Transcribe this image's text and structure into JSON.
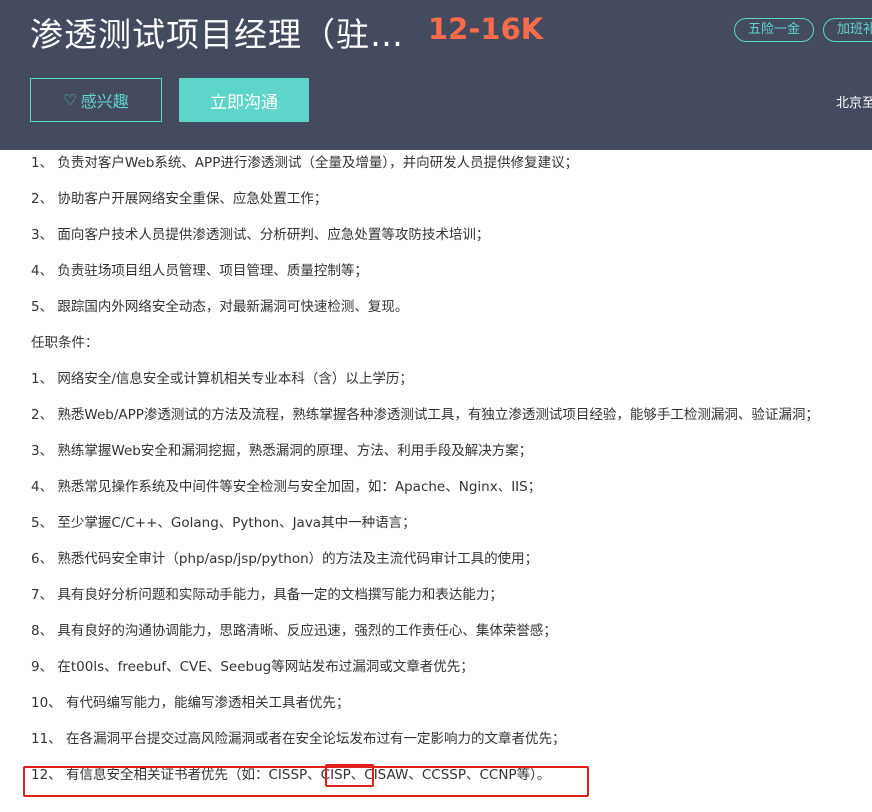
{
  "header": {
    "title": "渗透测试项目经理（驻…",
    "salary": "12-16K",
    "tags": [
      "五险一金",
      "加班补"
    ],
    "interest_label": "感兴趣",
    "chat_label": "立即沟通",
    "location": "北京至"
  },
  "colors": {
    "header_bg": "#444b5f",
    "accent": "#5dd5c8",
    "salary": "#ff6b4a",
    "highlight": "#e0201b"
  },
  "description": {
    "duties": [
      "1、 负责对客户Web系统、APP进行渗透测试（全量及增量），并向研发人员提供修复建议；",
      "2、 协助客户开展网络安全重保、应急处置工作；",
      "3、 面向客户技术人员提供渗透测试、分析研判、应急处置等攻防技术培训；",
      "4、 负责驻场项目组人员管理、项目管理、质量控制等；",
      "5、 跟踪国内外网络安全动态，对最新漏洞可快速检测、复现。"
    ],
    "requirements_heading": "任职条件：",
    "requirements": [
      "1、 网络安全/信息安全或计算机相关专业本科（含）以上学历；",
      "2、 熟悉Web/APP渗透测试的方法及流程，熟练掌握各种渗透测试工具，有独立渗透测试项目经验，能够手工检测漏洞、验证漏洞；",
      "3、 熟练掌握Web安全和漏洞挖掘，熟悉漏洞的原理、方法、利用手段及解决方案；",
      "4、 熟悉常见操作系统及中间件等安全检测与安全加固，如：Apache、Nginx、IIS；",
      "5、 至少掌握C/C++、Golang、Python、Java其中一种语言；",
      "6、 熟悉代码安全审计（php/asp/jsp/python）的方法及主流代码审计工具的使用；",
      "7、 具有良好分析问题和实际动手能力，具备一定的文档撰写能力和表达能力；",
      "8、 具有良好的沟通协调能力，思路清晰、反应迅速，强烈的工作责任心、集体荣誉感；",
      "9、 在t00ls、freebuf、CVE、Seebug等网站发布过漏洞或文章者优先；",
      "10、 有代码编写能力，能编写渗透相关工具者优先；",
      "11、 在各漏洞平台提交过高风险漏洞或者在安全论坛发布过有一定影响力的文章者优先；",
      "12、 有信息安全相关证书者优先（如：CISSP、CISP、CISAW、CCSSP、CCNP等）。"
    ]
  }
}
